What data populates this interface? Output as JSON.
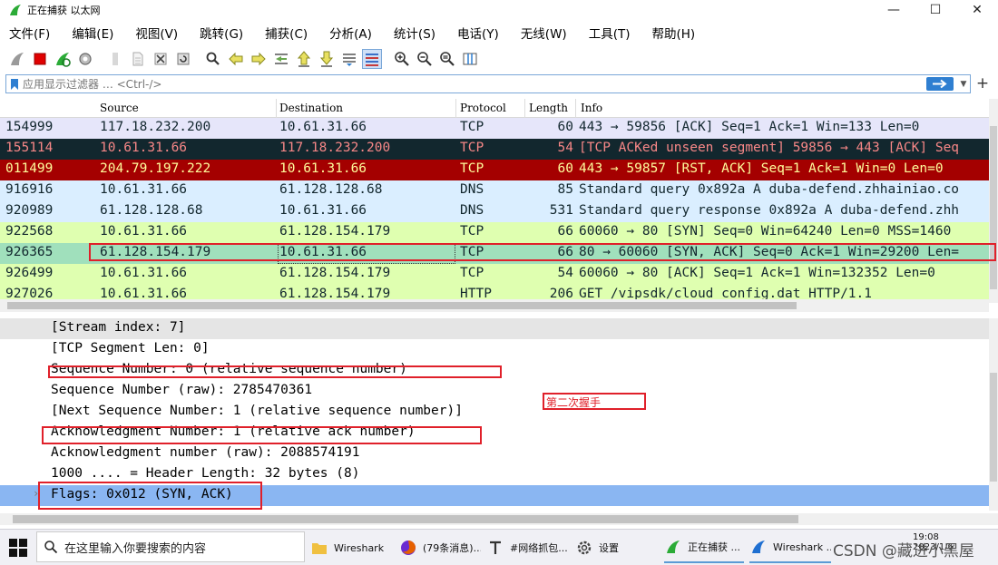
{
  "window": {
    "title": "正在捕获 以太网",
    "controls": [
      "—",
      "☐",
      "✕"
    ]
  },
  "menu": [
    "文件(F)",
    "编辑(E)",
    "视图(V)",
    "跳转(G)",
    "捕获(C)",
    "分析(A)",
    "统计(S)",
    "电话(Y)",
    "无线(W)",
    "工具(T)",
    "帮助(H)"
  ],
  "filter": {
    "placeholder": "应用显示过滤器 … <Ctrl-/>"
  },
  "columns": [
    "Source",
    "Destination",
    "Protocol",
    "Length",
    "Info"
  ],
  "packets": [
    {
      "no": "154999",
      "src": "117.18.232.200",
      "dst": "10.61.31.66",
      "proto": "TCP",
      "len": "60",
      "info": "443 → 59856 [ACK] Seq=1 Ack=1 Win=133 Len=0",
      "bg": "#e6e6fa",
      "fg": "#12272e"
    },
    {
      "no": "155114",
      "src": "10.61.31.66",
      "dst": "117.18.232.200",
      "proto": "TCP",
      "len": "54",
      "info": "[TCP ACKed unseen segment] 59856 → 443 [ACK] Seq",
      "bg": "#12272e",
      "fg": "#f78787"
    },
    {
      "no": "011499",
      "src": "204.79.197.222",
      "dst": "10.61.31.66",
      "proto": "TCP",
      "len": "60",
      "info": "443 → 59857 [RST, ACK] Seq=1 Ack=1 Win=0 Len=0",
      "bg": "#a40000",
      "fg": "#fffc9c"
    },
    {
      "no": "916916",
      "src": "10.61.31.66",
      "dst": "61.128.128.68",
      "proto": "DNS",
      "len": "85",
      "info": "Standard query 0x892a A duba-defend.zhhainiao.co",
      "bg": "#daeeff",
      "fg": "#12272e"
    },
    {
      "no": "920989",
      "src": "61.128.128.68",
      "dst": "10.61.31.66",
      "proto": "DNS",
      "len": "531",
      "info": "Standard query response 0x892a A duba-defend.zhh",
      "bg": "#daeeff",
      "fg": "#12272e"
    },
    {
      "no": "922568",
      "src": "10.61.31.66",
      "dst": "61.128.154.179",
      "proto": "TCP",
      "len": "66",
      "info": "60060 → 80 [SYN] Seq=0 Win=64240 Len=0 MSS=1460",
      "bg": "#dfffb0",
      "fg": "#12272e"
    },
    {
      "no": "926365",
      "src": "61.128.154.179",
      "dst": "10.61.31.66",
      "proto": "TCP",
      "len": "66",
      "info": "80 → 60060 [SYN, ACK] Seq=0 Ack=1 Win=29200 Len=",
      "bg": "#a0e0bc",
      "fg": "#12272e"
    },
    {
      "no": "926499",
      "src": "10.61.31.66",
      "dst": "61.128.154.179",
      "proto": "TCP",
      "len": "54",
      "info": "60060 → 80 [ACK] Seq=1 Ack=1 Win=132352 Len=0",
      "bg": "#dfffb0",
      "fg": "#12272e"
    },
    {
      "no": "927026",
      "src": "10.61.31.66",
      "dst": "61.128.154.179",
      "proto": "HTTP",
      "len": "206",
      "info": "GET /vipsdk/cloud_config.dat HTTP/1.1",
      "bg": "#dfffb0",
      "fg": "#12272e"
    }
  ],
  "details": [
    {
      "text": "[Stream index: 7]",
      "hl": "gray"
    },
    {
      "text": "[TCP Segment Len: 0]",
      "hl": ""
    },
    {
      "text": "Sequence Number: 0    (relative sequence number)",
      "hl": ""
    },
    {
      "text": "Sequence Number (raw): 2785470361",
      "hl": ""
    },
    {
      "text": "[Next Sequence Number: 1    (relative sequence number)]",
      "hl": ""
    },
    {
      "text": "Acknowledgment Number: 1    (relative ack number)",
      "hl": ""
    },
    {
      "text": "Acknowledgment number (raw): 2088574191",
      "hl": ""
    },
    {
      "text": "1000 .... = Header Length: 32 bytes (8)",
      "hl": ""
    },
    {
      "text": "Flags: 0x012 (SYN, ACK)",
      "hl": "blue"
    }
  ],
  "annotation_label": "第二次握手",
  "colors": {
    "annotation": "#e0202a",
    "accent": "#2f7fd1"
  },
  "taskbar": {
    "search_placeholder": "在这里输入你要搜索的内容",
    "tasks": [
      {
        "label": "Wireshark",
        "icon": "folder-icon",
        "color": "#f0c040"
      },
      {
        "label": "(79条消息)...",
        "icon": "firefox-icon",
        "color": "#e66000"
      },
      {
        "label": "#网络抓包...",
        "icon": "text-editor-icon",
        "color": "#333333"
      },
      {
        "label": "设置",
        "icon": "gear-icon",
        "color": "#444444"
      },
      {
        "label": "正在捕获 ...",
        "icon": "wireshark-capture-icon",
        "color": "#2bab37"
      },
      {
        "label": "Wireshark ...",
        "icon": "wireshark-icon",
        "color": "#1f6fd1"
      }
    ],
    "clock_time": "19:08",
    "clock_date": "2023/1/6"
  },
  "watermark": "CSDN @藏进小黑屋"
}
